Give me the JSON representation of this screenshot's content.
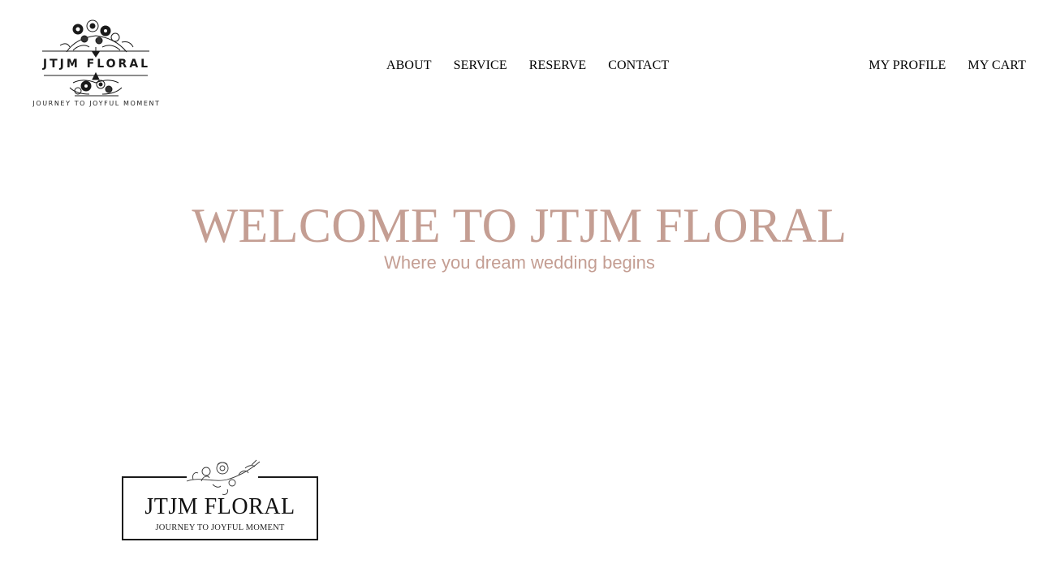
{
  "header": {
    "logo": {
      "title": "JTJM FLORAL",
      "tagline": "JOURNEY TO JOYFUL MOMENT",
      "icon": "floral-ornament-icon"
    },
    "nav": [
      {
        "label": "ABOUT"
      },
      {
        "label": "SERVICE"
      },
      {
        "label": "RESERVE"
      },
      {
        "label": "CONTACT"
      }
    ],
    "account": [
      {
        "label": "MY PROFILE"
      },
      {
        "label": "MY CART"
      }
    ]
  },
  "hero": {
    "title": "WELCOME TO JTJM FLORAL",
    "subtitle": "Where you dream wedding begins"
  },
  "brand_card": {
    "name": "JTJM FLORAL",
    "tagline": "JOURNEY TO JOYFUL MOMENT",
    "icon": "floral-branch-icon"
  },
  "colors": {
    "accent": "#c49e93",
    "text": "#000000",
    "background": "#ffffff"
  }
}
